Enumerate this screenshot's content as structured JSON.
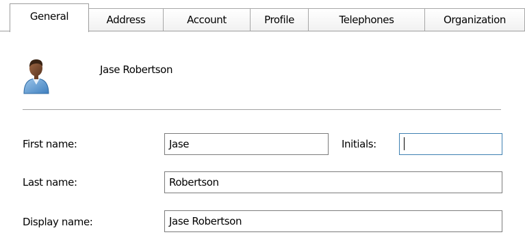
{
  "tabs": [
    {
      "label": "General",
      "active": true
    },
    {
      "label": "Address",
      "active": false
    },
    {
      "label": "Account",
      "active": false
    },
    {
      "label": "Profile",
      "active": false
    },
    {
      "label": "Telephones",
      "active": false
    },
    {
      "label": "Organization",
      "active": false
    }
  ],
  "header": {
    "display_name": "Jase Robertson",
    "icon": "user-icon"
  },
  "form": {
    "first_name_label": "First name:",
    "first_name_value": "Jase",
    "initials_label": "Initials:",
    "initials_value": "",
    "last_name_label": "Last name:",
    "last_name_value": "Robertson",
    "display_name_label": "Display name:",
    "display_name_value": "Jase Robertson"
  },
  "colors": {
    "tab_border": "#a6a6a6",
    "focus_border": "#3c7fb1",
    "field_border": "#7a7a7a"
  }
}
